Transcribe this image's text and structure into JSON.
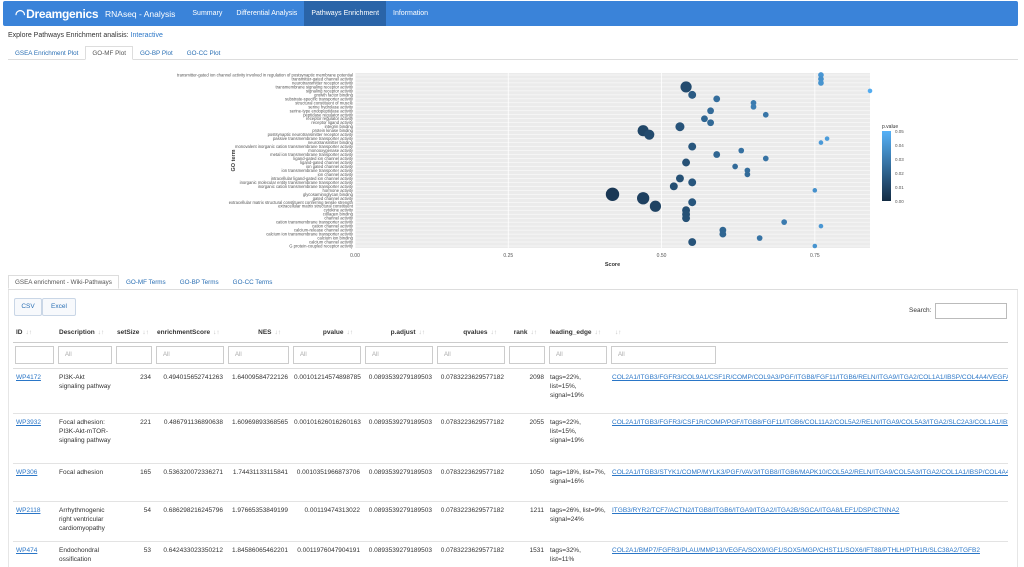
{
  "brand": {
    "name": "Dreamgenics",
    "app_title": "RNAseq - Analysis"
  },
  "nav": [
    {
      "label": "Summary",
      "active": false
    },
    {
      "label": "Differential Analysis",
      "active": false
    },
    {
      "label": "Pathways Enrichment",
      "active": true
    },
    {
      "label": "Information",
      "active": false
    }
  ],
  "explore": {
    "prefix": "Explore Pathways Enrichment analisis: ",
    "link": "Interactive"
  },
  "plot_tabs": [
    "GSEA Enrichment Plot",
    "GO-MF Plot",
    "GO-BP Plot",
    "GO-CC Plot"
  ],
  "plot_tabs_active": 1,
  "chart_data": {
    "type": "scatter",
    "xlabel": "Score",
    "ylabel": "GO term",
    "xticks": [
      "0.00",
      "0.25",
      "0.50",
      "0.75"
    ],
    "xlim": [
      0,
      0.84
    ],
    "categories": [
      "transmitter-gated ion channel activity involved in regulation of postsynaptic membrane potential",
      "transmitter-gated channel activity",
      "neurotransmitter receptor activity",
      "transmembrane signaling receptor activity",
      "signaling receptor activity",
      "growth factor binding",
      "substrate-specific transporter activity",
      "structural constituent of muscle",
      "serine hydrolase activity",
      "serine-type endopeptidase activity",
      "peptidase regulator activity",
      "receptor regulator activity",
      "receptor ligand activity",
      "integrin binding",
      "protein kinase binding",
      "postsynaptic neurotransmitter receptor activity",
      "passive transmembrane transporter activity",
      "neurotransmitter binding",
      "monovalent inorganic cation transmembrane transporter activity",
      "monooxygenase activity",
      "metal ion transmembrane transporter activity",
      "ligand-gated ion channel activity",
      "ligand-gated channel activity",
      "ion gated channel activity",
      "ion transmembrane transporter activity",
      "ion channel activity",
      "intracellular ligand-gated ion channel activity",
      "inorganic molecular entity transmembrane transporter activity",
      "inorganic cation transmembrane transporter activity",
      "hormone activity",
      "glycosaminoglycan binding",
      "gated channel activity",
      "extracellular matrix structural constituent conferring tensile strength",
      "extracellular matrix structural constituent",
      "cytokine activity",
      "collagen binding",
      "channel activity",
      "cation transmembrane transporter activity",
      "cation channel activity",
      "calcium-release channel activity",
      "calcium ion transmembrane transporter activity",
      "calcium ion binding",
      "calcium channel activity",
      "G protein-coupled receptor activity"
    ],
    "series": [
      {
        "x": [
          0.76,
          0.76,
          0.76,
          0.54,
          0.84,
          0.55,
          0.59,
          0.65,
          0.65,
          0.58,
          0.67,
          0.57,
          0.58,
          0.53,
          0.47,
          0.48,
          0.77,
          0.76,
          0.55,
          0.63,
          0.59,
          0.67,
          0.54,
          0.62,
          0.64,
          0.64,
          0.53,
          0.55,
          0.52,
          0.75,
          0.42,
          0.47,
          0.55,
          0.49,
          0.54,
          0.54,
          0.54,
          0.7,
          0.76,
          0.6,
          0.6,
          0.66,
          0.55,
          0.75
        ],
        "pvalue": [
          0.04,
          0.038,
          0.039,
          0.012,
          0.048,
          0.018,
          0.025,
          0.03,
          0.031,
          0.024,
          0.028,
          0.022,
          0.023,
          0.015,
          0.01,
          0.012,
          0.042,
          0.041,
          0.016,
          0.026,
          0.022,
          0.027,
          0.014,
          0.024,
          0.025,
          0.024,
          0.014,
          0.016,
          0.013,
          0.038,
          0.005,
          0.008,
          0.016,
          0.009,
          0.013,
          0.014,
          0.014,
          0.03,
          0.04,
          0.022,
          0.022,
          0.027,
          0.015,
          0.039
        ],
        "size": [
          3,
          3,
          3,
          8,
          2,
          5,
          4,
          3,
          3,
          4,
          3,
          4,
          4,
          6,
          8,
          7,
          2,
          2,
          5,
          3,
          4,
          3,
          5,
          3,
          3,
          3,
          5,
          5,
          5,
          2,
          10,
          9,
          5,
          8,
          5,
          5,
          5,
          3,
          2,
          4,
          4,
          3,
          5,
          2
        ]
      }
    ],
    "legend": {
      "title": "p.value",
      "ticks": [
        "0.05",
        "0.04",
        "0.03",
        "0.02",
        "0.01",
        "0.00"
      ],
      "placement": "right"
    },
    "colors": {
      "low": "#132b43",
      "high": "#56b1f7",
      "panel": "#ebebeb"
    }
  },
  "result_tabs": [
    "GSEA enrichment - Wiki-Pathways",
    "GO-MF Terms",
    "GO-BP Terms",
    "GO-CC Terms"
  ],
  "result_tabs_active": 0,
  "buttons": {
    "csv": "CSV",
    "excel": "Excel"
  },
  "search": {
    "label": "Search:"
  },
  "table": {
    "headers": [
      "ID",
      "Description",
      "setSize",
      "enrichmentScore",
      "NES",
      "pvalue",
      "p.adjust",
      "qvalues",
      "rank",
      "leading_edge",
      ""
    ],
    "filter_placeholder": "All",
    "rows": [
      {
        "id": "WP4172",
        "description": "PI3K-Akt signaling pathway",
        "setSize": "234",
        "enrichmentScore": "0.494015652741263",
        "NES": "1.64009584722126",
        "pvalue": "0.00101214574898785",
        "p_adjust": "0.0893539279189503",
        "qvalues": "0.0783223629577182",
        "rank": "2098",
        "leading_edge": "tags=22%, list=15%, signal=19%",
        "genes": "COL2A1/ITGB3/FGFR3/COL9A1/CSF1R/COMP/COL9A3/PGF/ITGB8/FGF11/ITGB6/RELN/ITGA9/ITGA2/COL1A1/IBSP/COL4A4/VEGFA/DDI"
      },
      {
        "id": "WP3932",
        "description": "Focal adhesion: PI3K-Akt-mTOR-signaling pathway",
        "setSize": "221",
        "enrichmentScore": "0.486791136890638",
        "NES": "1.60969893368565",
        "pvalue": "0.00101626016260163",
        "p_adjust": "0.0893539279189503",
        "qvalues": "0.0783223629577182",
        "rank": "2055",
        "leading_edge": "tags=22%, list=15%, signal=19%",
        "genes": "COL2A1/ITGB3/FGFR3/CSF1R/COMP/PGF/ITGB8/FGF11/ITGB6/COL11A2/COL5A2/RELN/ITGA9/COL5A3/ITGA2/SLC2A3/COL1A1/IBSP/CO"
      },
      {
        "id": "WP306",
        "description": "Focal adhesion",
        "setSize": "165",
        "enrichmentScore": "0.536320072336271",
        "NES": "1.74431133115841",
        "pvalue": "0.0010351966873706",
        "p_adjust": "0.0893539279189503",
        "qvalues": "0.0783223629577182",
        "rank": "1050",
        "leading_edge": "tags=18%, list=7%, signal=16%",
        "genes": "COL2A1/ITGB3/STYK1/COMP/MYLK3/PGF/VAV3/ITGB8/ITGB6/MAPK10/COL5A2/RELN/ITGA9/COL5A3/ITGA2/COL1A1/IBSP/COL4A4/VEG"
      },
      {
        "id": "WP2118",
        "description": "Arrhythmogenic right ventricular cardiomyopathy",
        "setSize": "54",
        "enrichmentScore": "0.686298216245796",
        "NES": "1.97665353849199",
        "pvalue": "0.00119474313022",
        "p_adjust": "0.0893539279189503",
        "qvalues": "0.0783223629577182",
        "rank": "1211",
        "leading_edge": "tags=26%, list=9%, signal=24%",
        "genes": "ITGB3/RYR2/TCF7/ACTN2/ITGB8/ITGB6/ITGA9/ITGA2/ITGA2B/SGCA/ITGA8/LEF1/DSP/CTNNA2"
      },
      {
        "id": "WP474",
        "description": "Endochondral ossification",
        "setSize": "53",
        "enrichmentScore": "0.642433023350212",
        "NES": "1.84586065462201",
        "pvalue": "0.0011976047904191",
        "p_adjust": "0.0893539279189503",
        "qvalues": "0.0783223629577182",
        "rank": "1531",
        "leading_edge": "tags=32%, list=11%",
        "genes": "COL2A1/BMP7/FGFR3/PLAU/MMP13/VEGFA/SOX9/IGF1/SOX5/MGP/CHST11/SOX6/IFT88/PTHLH/PTH1R/SLC38A2/TGFB2"
      }
    ]
  }
}
